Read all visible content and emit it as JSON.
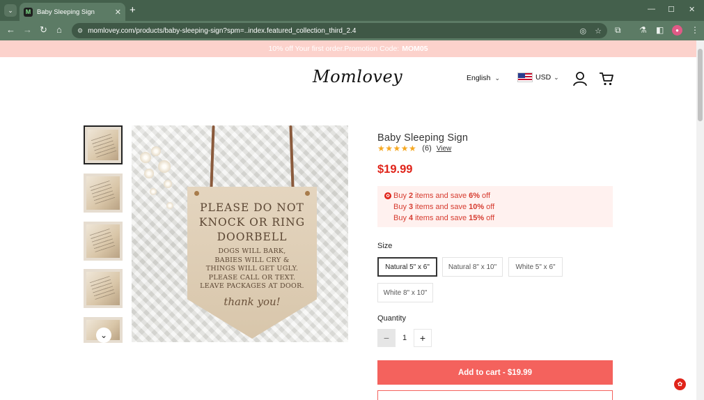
{
  "browser": {
    "tab_title": "Baby Sleeping Sign",
    "favicon_letter": "M",
    "url": "momlovey.com/products/baby-sleeping-sign?spm=..index.featured_collection_third_2.4",
    "profile_initial": "👓"
  },
  "promo": {
    "text": "10% off Your first order.Promotion Code:",
    "code": "MOM05"
  },
  "header": {
    "logo": "Momlovey",
    "language": "English",
    "currency": "USD"
  },
  "product": {
    "title": "Baby Sleeping Sign",
    "rating_stars": "★★★★★",
    "rating": 4.5,
    "review_count": "(6)",
    "view_link": "View",
    "price": "$19.99",
    "offers": [
      {
        "prefix": "Buy",
        "qty": "2",
        "mid": "items and save",
        "pct": "6%",
        "suffix": "off"
      },
      {
        "prefix": "Buy",
        "qty": "3",
        "mid": "items and save",
        "pct": "10%",
        "suffix": "off"
      },
      {
        "prefix": "Buy",
        "qty": "4",
        "mid": "items and save",
        "pct": "15%",
        "suffix": "off"
      }
    ],
    "size_label": "Size",
    "sizes": [
      "Natural 5\" x 6\"",
      "Natural 8\" x 10\"",
      "White 5\" x 6\"",
      "White 8\" x 10\""
    ],
    "selected_size": "Natural 5\" x 6\"",
    "quantity_label": "Quantity",
    "quantity": "1",
    "add_to_cart": "Add to cart - $19.99"
  },
  "image_text": {
    "line1": "PLEASE DO NOT",
    "line2": "KNOCK OR RING",
    "line3": "DOORBELL",
    "small1": "DOGS WILL BARK,",
    "small2": "BABIES WILL CRY &",
    "small3": "THINGS WILL GET UGLY.",
    "small4": "PLEASE CALL OR TEXT.",
    "small5": "LEAVE PACKAGES AT DOOR.",
    "thanks": "thank you!"
  },
  "colors": {
    "accent": "#f4625d",
    "price": "#e0241a",
    "promo_bg": "#fcd2cc",
    "star": "#f6a821",
    "chrome": "#44604c"
  },
  "icons": [
    "tab-menu-icon",
    "close-icon",
    "plus-icon",
    "back-icon",
    "forward-icon",
    "reload-icon",
    "home-icon",
    "site-info-icon",
    "eye-off-icon",
    "star-icon",
    "extensions-icon",
    "labs-icon",
    "sidebar-icon",
    "kebab-icon",
    "user-icon",
    "cart-icon",
    "chevron-down-icon",
    "chat-icon"
  ]
}
